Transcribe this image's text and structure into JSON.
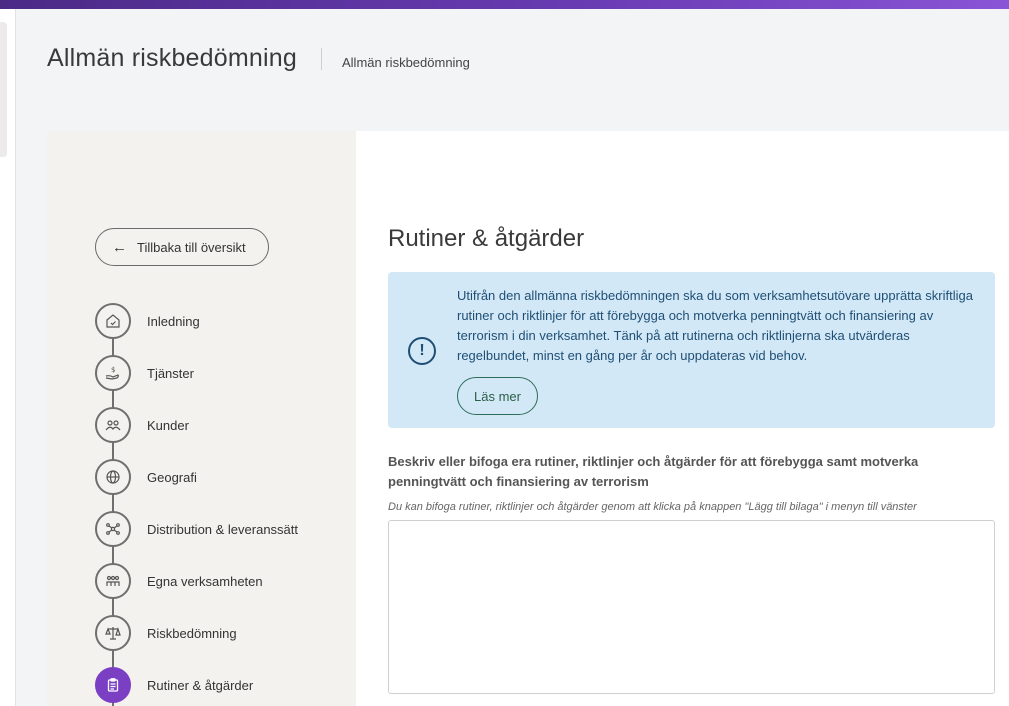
{
  "header": {
    "title": "Allmän riskbedömning",
    "breadcrumb": "Allmän riskbedömning"
  },
  "nav": {
    "back_label": "Tillbaka till översikt",
    "steps": [
      {
        "label": "Inledning",
        "icon": "house-check-icon",
        "active": false
      },
      {
        "label": "Tjänster",
        "icon": "hand-coin-icon",
        "active": false
      },
      {
        "label": "Kunder",
        "icon": "people-icon",
        "active": false
      },
      {
        "label": "Geografi",
        "icon": "globe-icon",
        "active": false
      },
      {
        "label": "Distribution & leveranssätt",
        "icon": "network-icon",
        "active": false
      },
      {
        "label": "Egna verksamheten",
        "icon": "team-icon",
        "active": false
      },
      {
        "label": "Riskbedömning",
        "icon": "scales-icon",
        "active": false
      },
      {
        "label": "Rutiner & åtgärder",
        "icon": "clipboard-icon",
        "active": true
      }
    ]
  },
  "main": {
    "section_title": "Rutiner & åtgärder",
    "info": {
      "text": "Utifrån den allmänna riskbedömningen ska du som verksamhetsutövare upprätta skriftliga rutiner och riktlinjer för att förebygga och motverka penningtvätt och finansiering av terrorism i din verksamhet. Tänk på att rutinerna och riktlinjerna ska utvärderas regelbundet, minst en gång per år och uppdateras vid behov.",
      "button_label": "Läs mer"
    },
    "field": {
      "label": "Beskriv eller bifoga era rutiner, riktlinjer och åtgärder för att förebygga samt motverka penningtvätt och finansiering av terrorism",
      "hint": "Du kan bifoga rutiner, riktlinjer och åtgärder genom att klicka på knappen \"Lägg till bilaga\" i menyn till vänster",
      "value": ""
    }
  },
  "colors": {
    "accent": "#7b3fc4",
    "info_bg": "#d3e8f7",
    "info_text": "#1f4f74",
    "nav_bg": "#f4f2ee"
  }
}
